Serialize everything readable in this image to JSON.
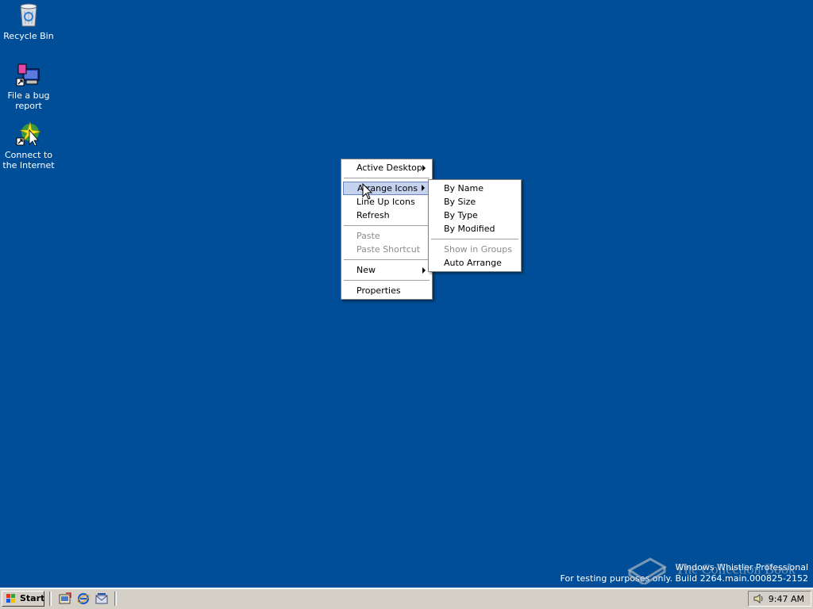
{
  "desktop": {
    "icons": [
      {
        "label": "Recycle Bin",
        "icon": "recycle-bin-icon"
      },
      {
        "label": "File a bug report",
        "icon": "bug-report-shortcut-icon"
      },
      {
        "label": "Connect to the Internet",
        "icon": "internet-connect-shortcut-icon"
      }
    ]
  },
  "context_menu": {
    "items": [
      {
        "label": "Active Desktop",
        "submenu": true,
        "disabled": false
      },
      {
        "label": "Arrange Icons",
        "submenu": true,
        "disabled": false,
        "selected": true
      },
      {
        "label": "Line Up Icons",
        "submenu": false,
        "disabled": false
      },
      {
        "label": "Refresh",
        "submenu": false,
        "disabled": false
      },
      {
        "label": "Paste",
        "submenu": false,
        "disabled": true
      },
      {
        "label": "Paste Shortcut",
        "submenu": false,
        "disabled": true
      },
      {
        "label": "New",
        "submenu": true,
        "disabled": false
      },
      {
        "label": "Properties",
        "submenu": false,
        "disabled": false
      }
    ]
  },
  "submenu_arrange": {
    "items": [
      {
        "label": "By Name",
        "disabled": false
      },
      {
        "label": "By Size",
        "disabled": false
      },
      {
        "label": "By Type",
        "disabled": false
      },
      {
        "label": "By Modified",
        "disabled": false
      },
      {
        "label": "Show in Groups",
        "disabled": true
      },
      {
        "label": "Auto Arrange",
        "disabled": false
      }
    ]
  },
  "watermark": {
    "line1": "Windows Whistler Professional",
    "line2": "For testing purposes only. Build 2264.main.000825-2152",
    "overlay": "The Collection Book"
  },
  "taskbar": {
    "start_label": "Start",
    "quick_launch": [
      "show-desktop-icon",
      "internet-explorer-icon",
      "outlook-express-icon"
    ],
    "tray_icons": [
      "volume-icon"
    ],
    "clock": "9:47 AM"
  },
  "colors": {
    "desktop_bg": "#004e98",
    "menu_highlight": "#c6d3ef",
    "taskbar_bg": "#d4d0c8"
  }
}
